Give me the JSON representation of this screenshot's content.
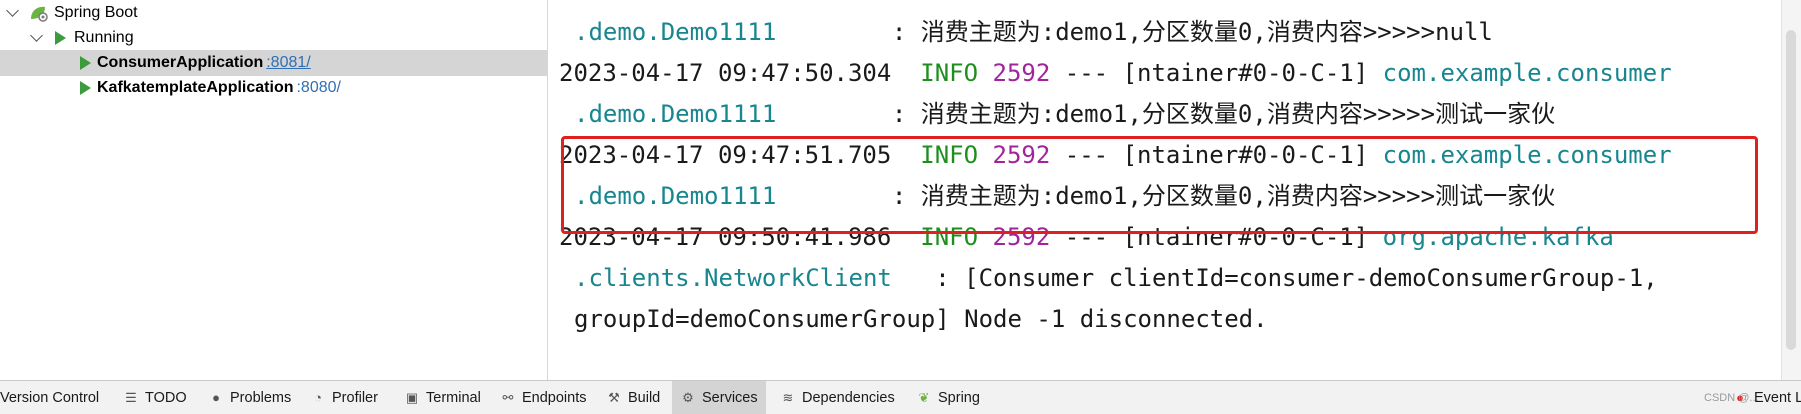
{
  "services": {
    "root_label": "Spring Boot",
    "group_label": "Running",
    "apps": [
      {
        "name": "ConsumerApplication",
        "port": ":8081/"
      },
      {
        "name": "KafkatemplateApplication",
        "port": ":8080/"
      }
    ]
  },
  "console": {
    "lines": [
      {
        "logger_cont": ".demo.Demo1111",
        "message": "        : 消费主题为:demo1,分区数量0,消费内容>>>>>null"
      },
      {
        "timestamp": "2023-04-17 09:47:50.304",
        "level": "INFO",
        "pid": "2592",
        "sep": "---",
        "thread": "[ntainer#0-0-C-1]",
        "logger": "com.example.consumer"
      },
      {
        "logger_cont": ".demo.Demo1111",
        "message": "        : 消费主题为:demo1,分区数量0,消费内容>>>>>测试一家伙"
      },
      {
        "timestamp": "2023-04-17 09:47:51.705",
        "level": "INFO",
        "pid": "2592",
        "sep": "---",
        "thread": "[ntainer#0-0-C-1]",
        "logger": "com.example.consumer"
      },
      {
        "logger_cont": ".demo.Demo1111",
        "message": "        : 消费主题为:demo1,分区数量0,消费内容>>>>>测试一家伙"
      },
      {
        "timestamp": "2023-04-17 09:50:41.986",
        "level": "INFO",
        "pid": "2592",
        "sep": "---",
        "thread": "[ntainer#0-0-C-1]",
        "logger": "org.apache.kafka"
      },
      {
        "logger_cont": ".clients.NetworkClient",
        "message": "   : [Consumer clientId=consumer-demoConsumerGroup-1,"
      },
      {
        "message": "groupId=demoConsumerGroup] Node -1 disconnected."
      }
    ]
  },
  "toolbar": {
    "items": [
      {
        "label": "Version Control",
        "icon": "version-control-icon"
      },
      {
        "label": "TODO",
        "icon": "list-icon"
      },
      {
        "label": "Problems",
        "icon": "problems-icon"
      },
      {
        "label": "Profiler",
        "icon": "profiler-icon"
      },
      {
        "label": "Terminal",
        "icon": "terminal-icon"
      },
      {
        "label": "Endpoints",
        "icon": "endpoints-icon"
      },
      {
        "label": "Build",
        "icon": "hammer-icon"
      },
      {
        "label": "Services",
        "icon": "services-icon",
        "active": true
      },
      {
        "label": "Dependencies",
        "icon": "layers-icon"
      },
      {
        "label": "Spring",
        "icon": "spring-leaf-icon"
      }
    ],
    "event_log": "Event L",
    "watermark": "CSDN @..."
  },
  "colors": {
    "highlight_border": "#e0201f",
    "logger_teal": "#17868f",
    "info_green": "#1e8f1e",
    "pid_purple": "#a0259d",
    "run_green": "#3d9a3d",
    "port_link": "#2f6fb5"
  }
}
